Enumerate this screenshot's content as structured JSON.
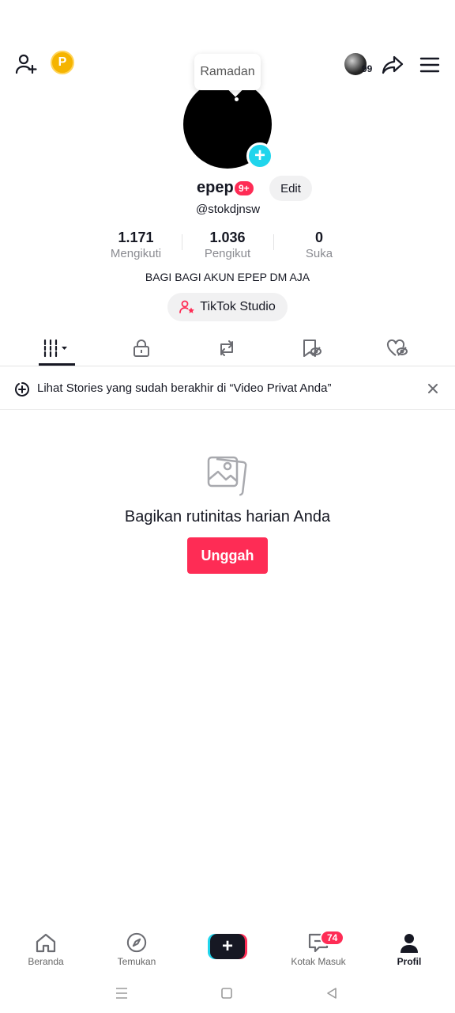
{
  "topbar": {
    "add_friend_icon": "person-plus-icon",
    "coin_label": "P",
    "mini_avatar_badge": "99",
    "share_icon": "share-arrow-icon",
    "menu_icon": "hamburger-menu-icon"
  },
  "tooltip": {
    "text": "Ramadan"
  },
  "profile": {
    "display_name": "epep",
    "name_badge": "9+",
    "edit_label": "Edit",
    "handle": "@stokdjnsw",
    "bio": "BAGI BAGI AKUN EPEP DM AJA",
    "studio_label": "TikTok Studio"
  },
  "stats": [
    {
      "value": "1.171",
      "label": "Mengikuti"
    },
    {
      "value": "1.036",
      "label": "Pengikut"
    },
    {
      "value": "0",
      "label": "Suka"
    }
  ],
  "tabs": [
    {
      "name": "videos-grid",
      "icon": "grid-icon",
      "active": true
    },
    {
      "name": "private",
      "icon": "lock-icon",
      "active": false
    },
    {
      "name": "reposts",
      "icon": "repost-icon",
      "active": false
    },
    {
      "name": "favorites",
      "icon": "bookmark-icon",
      "active": false
    },
    {
      "name": "liked",
      "icon": "heart-icon",
      "active": false
    }
  ],
  "banner": {
    "text": "Lihat Stories yang sudah berakhir di “Video Privat Anda”"
  },
  "empty_state": {
    "icon": "photos-icon",
    "title": "Bagikan rutinitas harian Anda",
    "button": "Unggah"
  },
  "bottom_nav": [
    {
      "label": "Beranda",
      "icon": "home-icon"
    },
    {
      "label": "Temukan",
      "icon": "compass-icon"
    },
    {
      "label": "",
      "icon": "create-plus-icon"
    },
    {
      "label": "Kotak Masuk",
      "icon": "inbox-icon",
      "badge": "74"
    },
    {
      "label": "Profil",
      "icon": "profile-icon",
      "active": true
    }
  ],
  "colors": {
    "accent": "#fe2c55",
    "cyan": "#20d5ec",
    "text": "#161823",
    "muted": "#8a8b91"
  }
}
